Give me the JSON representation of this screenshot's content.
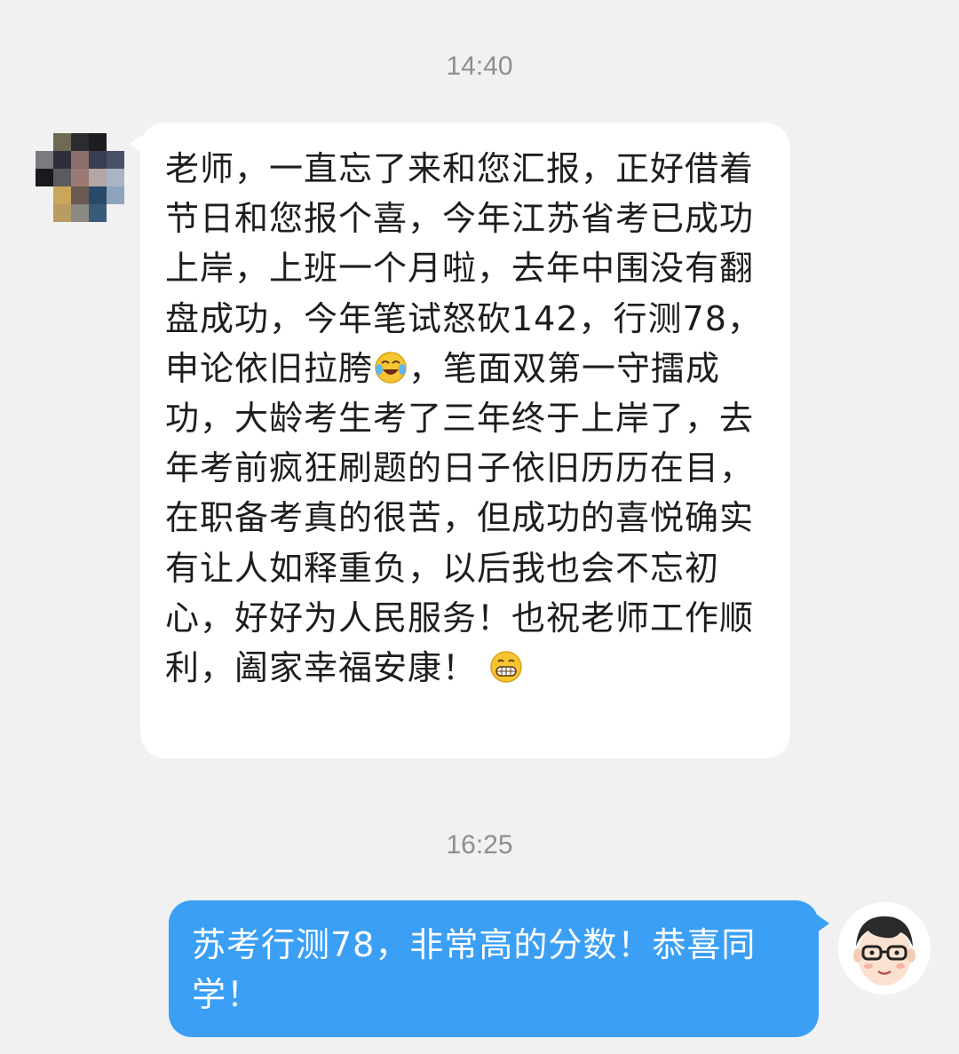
{
  "chat": {
    "timestamp_1": "14:40",
    "timestamp_2": "16:25",
    "incoming_message": {
      "segments": [
        "老师，一直忘了来和您汇报，正好借着节日和您报个喜，今年江苏省考已成功上岸，上班一个月啦，去年中围没有翻盘成功，今年笔试怒砍142，行测78，申论依旧拉胯",
        "，笔面双第一守擂成功，大龄考生考了三年终于上岸了，去年考前疯狂刷题的日子依旧历历在目，在职备考真的很苦，但成功的喜悦确实有让人如释重负，以后我也会不忘初心，好好为人民服务！也祝老师工作顺利，阖家幸福安康！"
      ],
      "emojis": [
        "laughing-crying-emoji",
        "grinning-emoji"
      ]
    },
    "outgoing_message": {
      "text": "苏考行测78，非常高的分数！恭喜同学！"
    },
    "colors": {
      "background": "#f1f1f1",
      "incoming_bubble": "#ffffff",
      "outgoing_bubble": "#3a9ff5",
      "timestamp": "#8e8e8e"
    }
  }
}
